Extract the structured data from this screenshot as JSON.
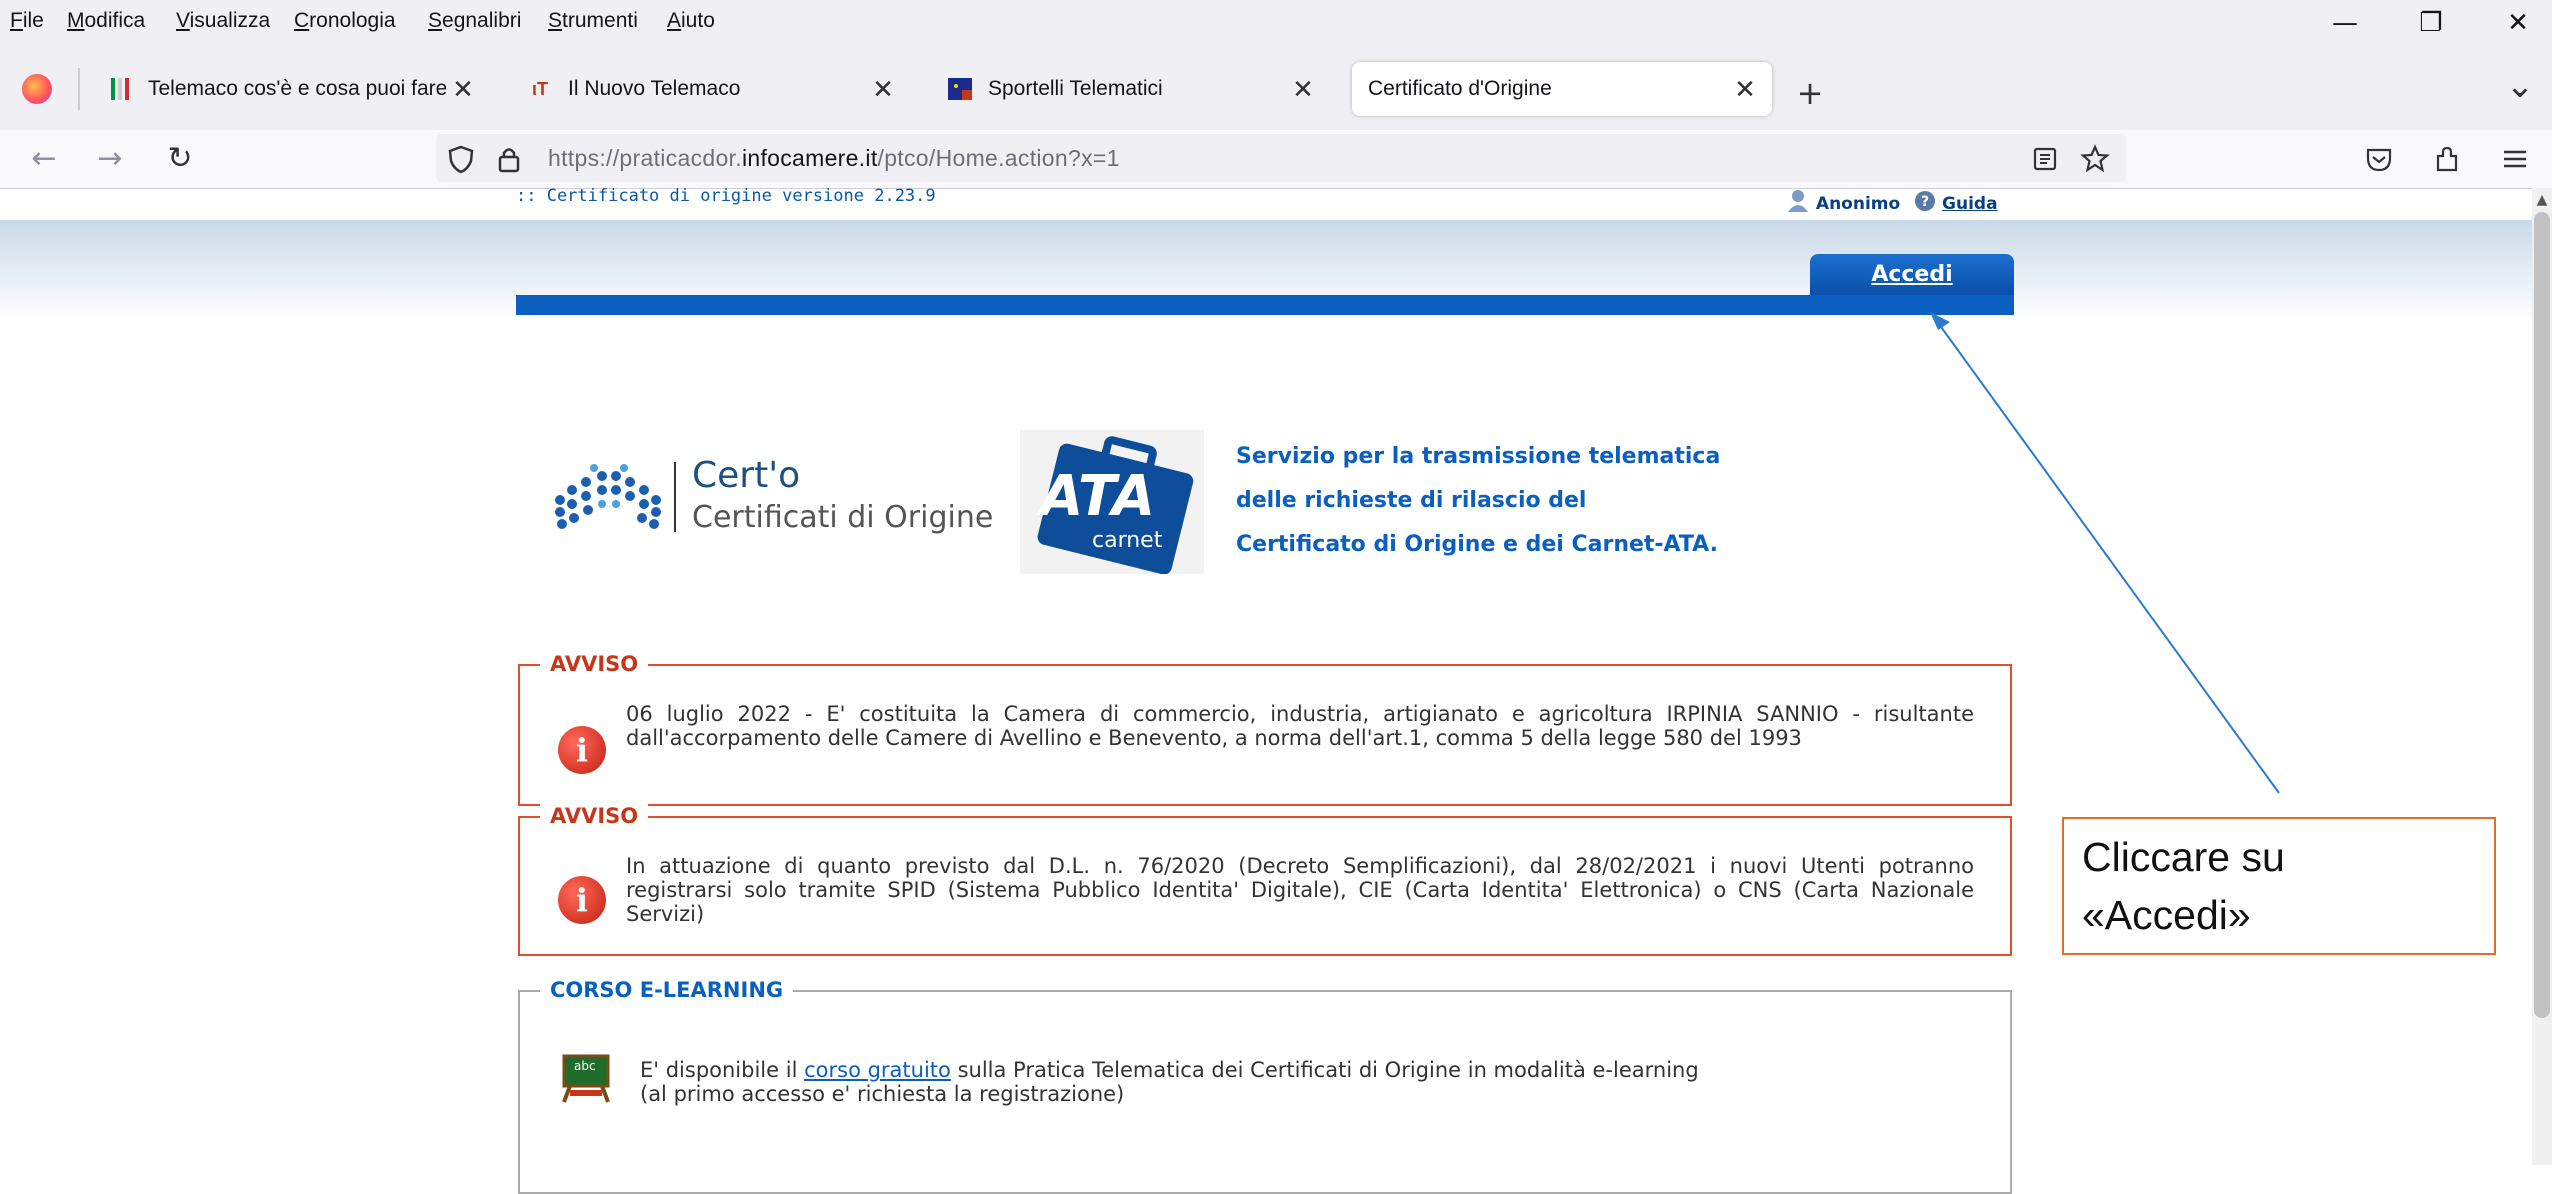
{
  "menu": [
    "File",
    "Modifica",
    "Visualizza",
    "Cronologia",
    "Segnalibri",
    "Strumenti",
    "Aiuto"
  ],
  "window_controls": {
    "minimize": "—",
    "restore": "❐",
    "close": "✕"
  },
  "tabs": [
    {
      "label": "Telemaco cos'è e cosa puoi fare",
      "active": false
    },
    {
      "label": "Il Nuovo Telemaco",
      "active": false
    },
    {
      "label": "Sportelli Telematici",
      "active": false
    },
    {
      "label": "Certificato d'Origine",
      "active": true
    }
  ],
  "new_tab": "+",
  "tab_list": "⌄",
  "nav": {
    "back": "←",
    "forward": "→",
    "reload": "↻"
  },
  "url": {
    "prefix": "https://praticacdor.",
    "domain": "infocamere.it",
    "suffix": "/ptco/Home.action?x=1"
  },
  "page": {
    "version": ":: Certificato di origine versione 2.23.9",
    "user": "Anonimo",
    "help": "Guida",
    "login_tab": "Accedi",
    "logo_title": "Cert'o",
    "logo_subtitle": "Certificati di Origine",
    "ata_logo": {
      "word": "ATA",
      "sub": "carnet"
    },
    "service_lines": [
      "Servizio per la trasmissione telematica",
      "delle richieste di rilascio del",
      "Certificato di Origine e dei Carnet-ATA."
    ],
    "notices": [
      {
        "title": "AVVISO",
        "text": "06 luglio 2022 - E' costituita la Camera di commercio, industria, artigianato e agricoltura IRPINIA SANNIO - risultante dall'accorpamento delle Camere di Avellino e Benevento, a norma dell'art.1, comma 5 della legge 580 del 1993"
      },
      {
        "title": "AVVISO",
        "text": "In attuazione di quanto previsto dal D.L. n. 76/2020 (Decreto Semplificazioni), dal 28/02/2021 i nuovi Utenti potranno registrarsi solo tramite SPID (Sistema Pubblico Identita' Digitale), CIE (Carta Identita' Elettronica) o CNS (Carta Nazionale Servizi)"
      }
    ],
    "elearning": {
      "title": "CORSO E-LEARNING",
      "text_before": "E' disponibile il ",
      "link": "corso gratuito",
      "text_after": " sulla Pratica Telematica dei Certificati di Origine in modalità e-learning",
      "line2": "(al primo accesso e' richiesta la registrazione)",
      "icon_label": "abc"
    }
  },
  "annotation": {
    "line1": "Cliccare su",
    "line2": "«Accedi»",
    "color": "#2a7bd0"
  },
  "colors": {
    "notice_border": "#e0502a",
    "notice_title": "#c8361a",
    "elearning_title": "#0a5fc0",
    "brand_blue": "#0a5fc0"
  }
}
